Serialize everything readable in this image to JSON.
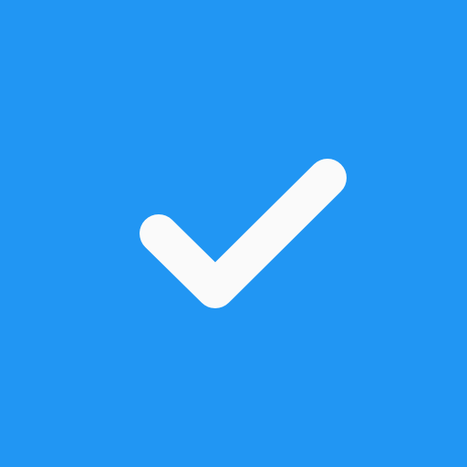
{
  "icon": {
    "name": "checkmark-icon",
    "background_color": "#2196F3",
    "stroke_color": "#FAFAFA"
  }
}
